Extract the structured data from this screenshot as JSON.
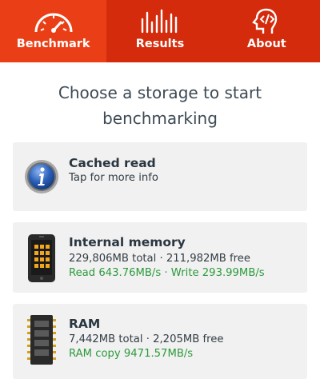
{
  "nav": {
    "tabs": [
      {
        "label": "Benchmark",
        "icon": "speedometer-icon"
      },
      {
        "label": "Results",
        "icon": "bar-chart-icon"
      },
      {
        "label": "About",
        "icon": "head-code-icon"
      }
    ],
    "active_tab": "Benchmark",
    "colors": {
      "bar": "#d42b0c",
      "active": "#ea3f16"
    }
  },
  "headline": "Choose a storage to start benchmarking",
  "storages": [
    {
      "title": "Cached read",
      "line1": "Tap for more info",
      "line2": "",
      "icon": "info-icon"
    },
    {
      "title": "Internal memory",
      "line1": "229,806MB total · 211,982MB free",
      "line2": "Read 643.76MB/s · Write 293.99MB/s",
      "icon": "phone-chip-icon"
    },
    {
      "title": "RAM",
      "line1": "7,442MB total · 2,205MB free",
      "line2": "RAM copy 9471.57MB/s",
      "icon": "ram-chip-icon"
    }
  ],
  "colors": {
    "result_text": "#2c9a3c",
    "title_text": "#2a3640"
  }
}
